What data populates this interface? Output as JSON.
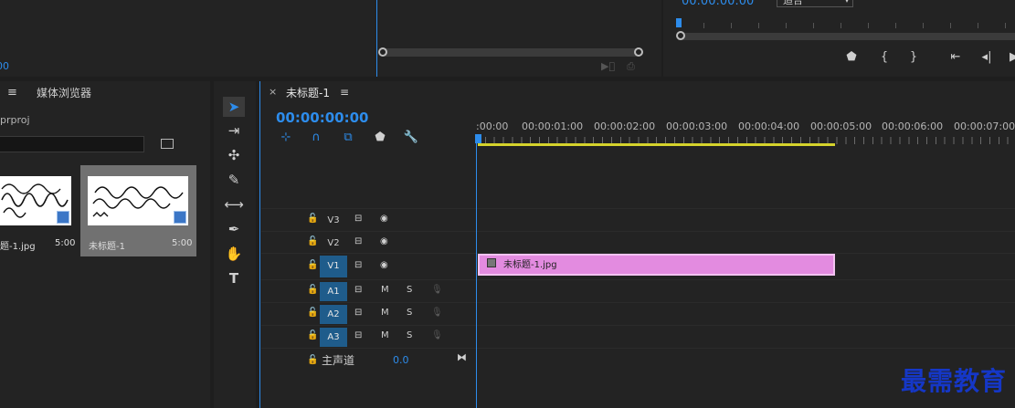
{
  "source_monitor": {
    "timecode": "00",
    "icons": [
      "export-frame-icon",
      "camera-icon"
    ]
  },
  "program_monitor": {
    "timecode": "00:00:00:00",
    "zoom_select": "适合",
    "buttons": [
      "marker-icon",
      "mark-in-icon",
      "mark-out-icon",
      "go-to-in-icon",
      "step-back-icon",
      "play-icon"
    ]
  },
  "project_panel": {
    "menu_glyph": "≡",
    "tab": "媒体浏览器",
    "project_name": "prproj",
    "items": [
      {
        "name": "题-1.jpg",
        "duration": "5:00"
      },
      {
        "name": "未标题-1",
        "duration": "5:00"
      }
    ]
  },
  "tools": [
    "selection-tool",
    "track-select-tool",
    "ripple-edit-tool",
    "razor-tool",
    "slip-tool",
    "pen-tool",
    "hand-tool",
    "type-tool"
  ],
  "timeline": {
    "close_glyph": "×",
    "sequence_title": "未标题-1",
    "menu_glyph": "≡",
    "timecode": "00:00:00:00",
    "ruler": [
      ":00:00",
      "00:00:01:00",
      "00:00:02:00",
      "00:00:03:00",
      "00:00:04:00",
      "00:00:05:00",
      "00:00:06:00",
      "00:00:07:00"
    ],
    "video_tracks": [
      {
        "name": "V3",
        "targeted": false
      },
      {
        "name": "V2",
        "targeted": false
      },
      {
        "name": "V1",
        "targeted": true
      }
    ],
    "audio_tracks": [
      {
        "name": "A1",
        "mute": "M",
        "solo": "S"
      },
      {
        "name": "A2",
        "mute": "M",
        "solo": "S"
      },
      {
        "name": "A3",
        "mute": "M",
        "solo": "S"
      }
    ],
    "clip": {
      "label": "未标题-1.jpg",
      "color": "#e38be0"
    },
    "master": {
      "label": "主声道",
      "value": "0.0"
    }
  },
  "watermark": "最需教育"
}
